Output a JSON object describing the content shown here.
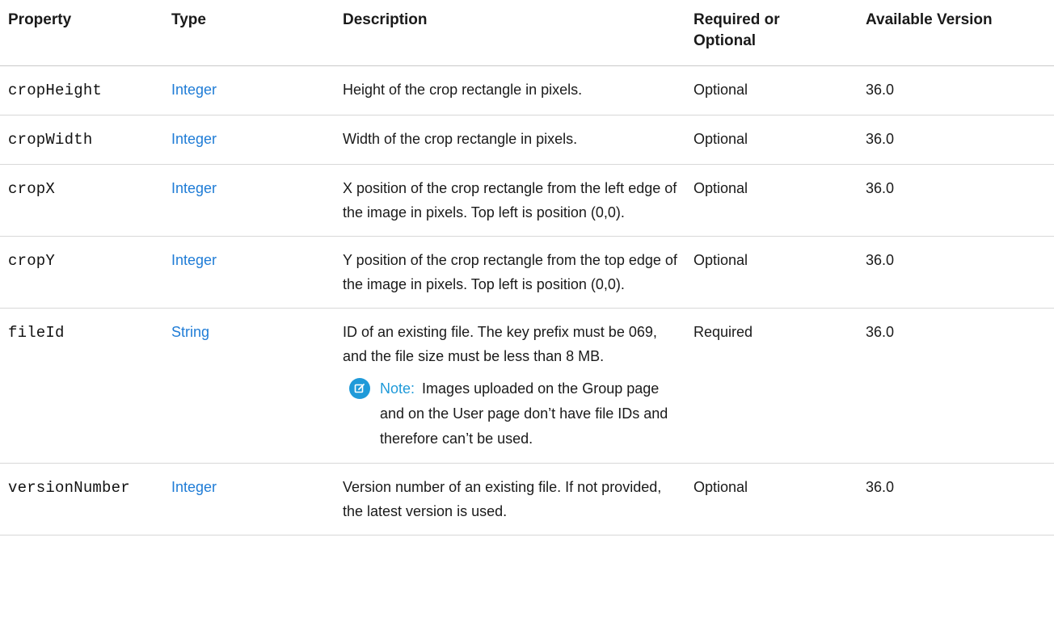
{
  "table": {
    "headers": {
      "property": "Property",
      "type": "Type",
      "description": "Description",
      "required_line1": "Required or",
      "required_line2": "Optional",
      "version": "Available Version"
    },
    "rows": [
      {
        "property": "cropHeight",
        "type": "Integer",
        "description": "Height of the crop rectangle in pixels.",
        "required": "Optional",
        "version": "36.0"
      },
      {
        "property": "cropWidth",
        "type": "Integer",
        "description": "Width of the crop rectangle in pixels.",
        "required": "Optional",
        "version": "36.0"
      },
      {
        "property": "cropX",
        "type": "Integer",
        "description": "X position of the crop rectangle from the left edge of the image in pixels. Top left is position (0,0).",
        "required": "Optional",
        "version": "36.0"
      },
      {
        "property": "cropY",
        "type": "Integer",
        "description": "Y position of the crop rectangle from the top edge of the image in pixels. Top left is position (0,0).",
        "required": "Optional",
        "version": "36.0"
      },
      {
        "property": "fileId",
        "type": "String",
        "description": "ID of an existing file. The key prefix must be 069, and the file size must be less than 8 MB.",
        "note_label": "Note:",
        "note_text": "Images uploaded on the Group page and on the User page don’t have file IDs and therefore can’t be used.",
        "note_icon": "edit-note-icon",
        "required": "Required",
        "version": "36.0"
      },
      {
        "property": "versionNumber",
        "type": "Integer",
        "description": "Version number of an existing file. If not provided, the latest version is used.",
        "required": "Optional",
        "version": "36.0"
      }
    ]
  },
  "colors": {
    "link": "#1f7cd6",
    "note_accent": "#1f9ad9",
    "row_divider": "#d8d8d8"
  }
}
